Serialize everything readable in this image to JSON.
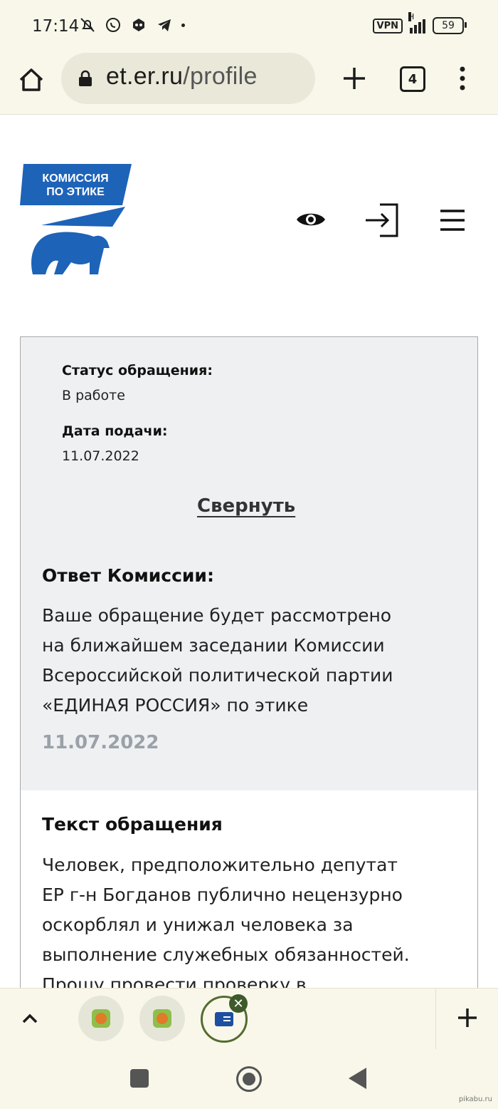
{
  "status_bar": {
    "time": "17:14",
    "vpn": "VPN",
    "network": "H",
    "battery": "59",
    "icons": [
      "muted-bell-icon",
      "whatsapp-icon",
      "game-controller-icon",
      "telegram-icon"
    ]
  },
  "browser": {
    "url_host": "et.er.ru",
    "url_path": "/profile",
    "tab_count": "4"
  },
  "site": {
    "logo_text_line1": "КОМИССИЯ",
    "logo_text_line2": "ПО ЭТИКЕ",
    "brand_color": "#1d63b8"
  },
  "request": {
    "status_label": "Статус обращения:",
    "status_value": "В работе",
    "date_label": "Дата подачи:",
    "date_value": "11.07.2022",
    "collapse_link": "Свернуть",
    "answer_heading": "Ответ Комиссии:",
    "answer_lines": [
      "Ваше обращение будет рассмотрено",
      "на ближайшем заседании Комиссии",
      "Всероссийской политической партии",
      "«ЕДИНАЯ РОССИЯ» по этике"
    ],
    "answer_date": "11.07.2022",
    "text_heading": "Текст обращения",
    "text_lines": [
      "Человек, предположительно депутат",
      "ЕР г-н Богданов публично нецензурно",
      "оскорблял и унижал человека за",
      "выполнение служебных обязанностей.",
      "Прошу провести проверку в"
    ]
  },
  "watermark": "pikabu.ru"
}
